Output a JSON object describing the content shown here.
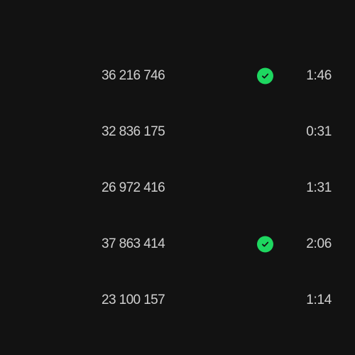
{
  "tracks": [
    {
      "plays": "36 216 746",
      "saved": true,
      "duration": "1:46"
    },
    {
      "plays": "32 836 175",
      "saved": false,
      "duration": "0:31"
    },
    {
      "plays": "26 972 416",
      "saved": false,
      "duration": "1:31"
    },
    {
      "plays": "37 863 414",
      "saved": true,
      "duration": "2:06"
    },
    {
      "plays": "23 100 157",
      "saved": false,
      "duration": "1:14"
    }
  ],
  "colors": {
    "background": "#121212",
    "text": "#cfcfcf",
    "saved_accent": "#1ed760"
  },
  "icons": {
    "saved": "check-circle-icon"
  }
}
